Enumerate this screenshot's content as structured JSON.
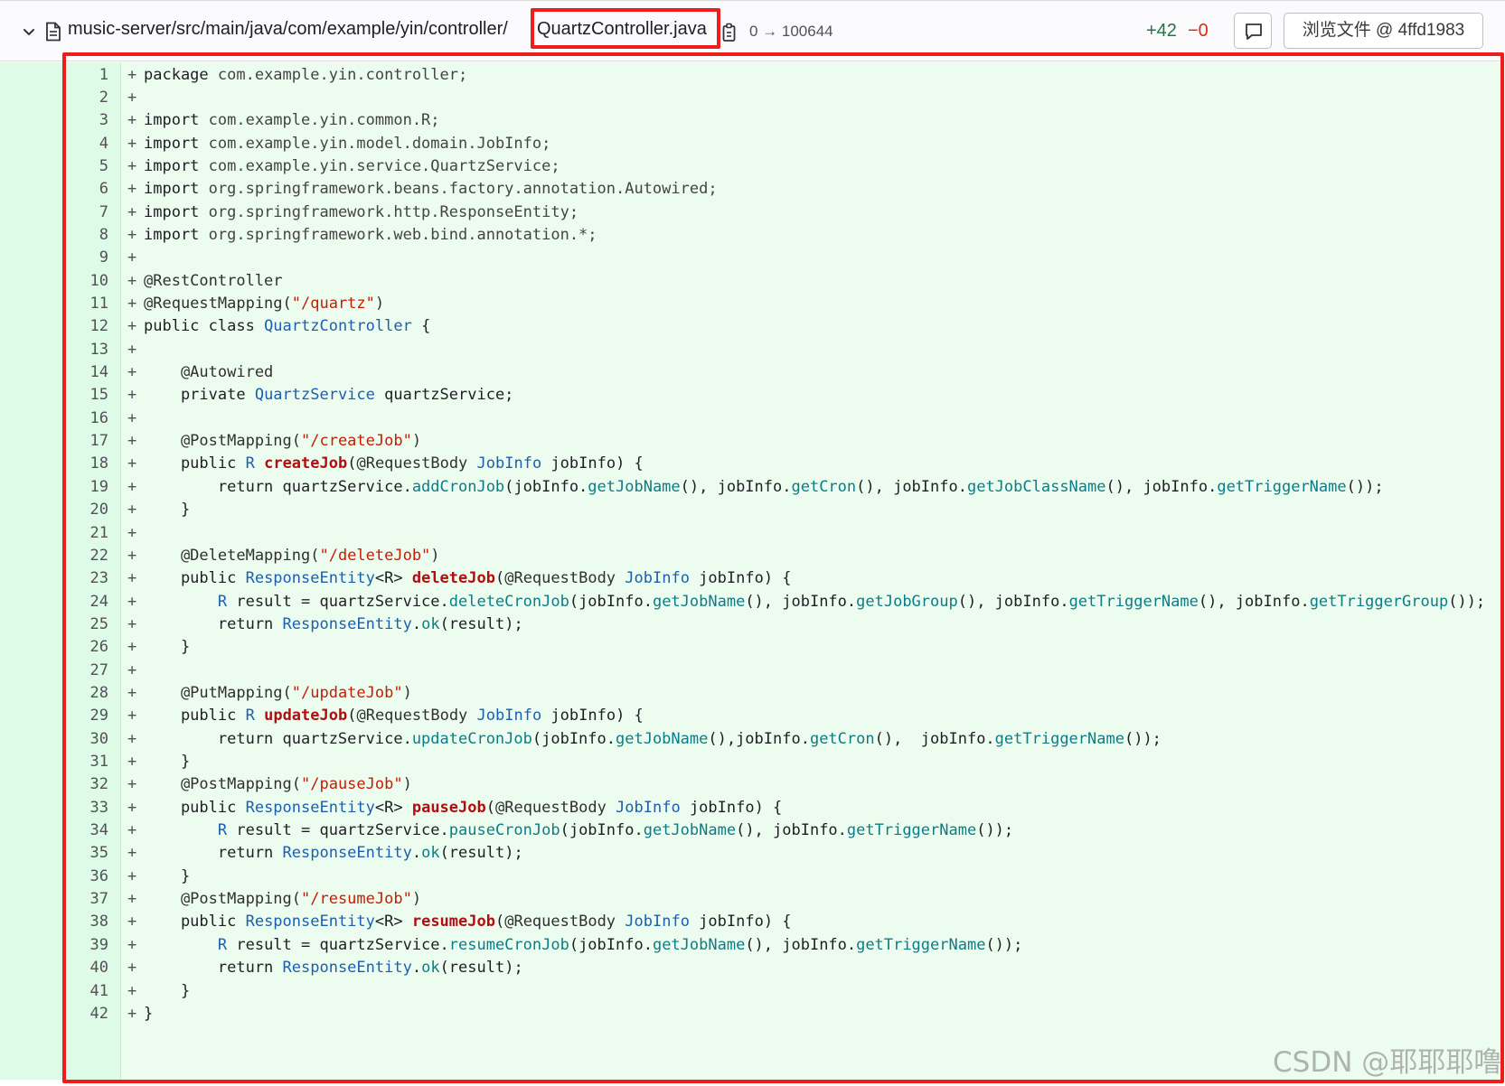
{
  "header": {
    "file_path": "music-server/src/main/java/com/example/yin/controller/",
    "file_name": "QuartzController.java",
    "mode_change": "0 → 100644",
    "additions": "+42",
    "deletions": "−0",
    "view_file_label": "浏览文件 @ 4ffd1983",
    "icons": [
      "chevron-down-icon",
      "file-icon",
      "copy-icon",
      "comment-icon"
    ]
  },
  "diff": {
    "lines": [
      {
        "n": "1",
        "tokens": [
          [
            "kw",
            "package"
          ],
          [
            "pkg",
            " com.example.yin.controller;"
          ]
        ]
      },
      {
        "n": "2",
        "tokens": []
      },
      {
        "n": "3",
        "tokens": [
          [
            "kw",
            "import"
          ],
          [
            "pkg",
            " com.example.yin.common.R;"
          ]
        ]
      },
      {
        "n": "4",
        "tokens": [
          [
            "kw",
            "import"
          ],
          [
            "pkg",
            " com.example.yin.model.domain.JobInfo;"
          ]
        ]
      },
      {
        "n": "5",
        "tokens": [
          [
            "kw",
            "import"
          ],
          [
            "pkg",
            " com.example.yin.service.QuartzService;"
          ]
        ]
      },
      {
        "n": "6",
        "tokens": [
          [
            "kw",
            "import"
          ],
          [
            "pkg",
            " org.springframework.beans.factory.annotation.Autowired;"
          ]
        ]
      },
      {
        "n": "7",
        "tokens": [
          [
            "kw",
            "import"
          ],
          [
            "pkg",
            " org.springframework.http.ResponseEntity;"
          ]
        ]
      },
      {
        "n": "8",
        "tokens": [
          [
            "kw",
            "import"
          ],
          [
            "pkg",
            " org.springframework.web.bind.annotation.*;"
          ]
        ]
      },
      {
        "n": "9",
        "tokens": []
      },
      {
        "n": "10",
        "tokens": [
          [
            "ann",
            "@RestController"
          ]
        ]
      },
      {
        "n": "11",
        "tokens": [
          [
            "ann",
            "@RequestMapping("
          ],
          [
            "str",
            "\"/quartz\""
          ],
          [
            "ann",
            ")"
          ]
        ]
      },
      {
        "n": "12",
        "tokens": [
          [
            "kw",
            "public class "
          ],
          [
            "type",
            "QuartzController"
          ],
          [
            "kw",
            " {"
          ]
        ]
      },
      {
        "n": "13",
        "tokens": []
      },
      {
        "n": "14",
        "tokens": [
          [
            "ann",
            "    @Autowired"
          ]
        ]
      },
      {
        "n": "15",
        "tokens": [
          [
            "kw",
            "    private "
          ],
          [
            "type",
            "QuartzService"
          ],
          [
            "kw",
            " quartzService;"
          ]
        ]
      },
      {
        "n": "16",
        "tokens": []
      },
      {
        "n": "17",
        "tokens": [
          [
            "ann",
            "    @PostMapping("
          ],
          [
            "str",
            "\"/createJob\""
          ],
          [
            "ann",
            ")"
          ]
        ]
      },
      {
        "n": "18",
        "tokens": [
          [
            "kw",
            "    public "
          ],
          [
            "type",
            "R"
          ],
          [
            "kw",
            " "
          ],
          [
            "def",
            "createJob"
          ],
          [
            "kw",
            "("
          ],
          [
            "ann",
            "@RequestBody "
          ],
          [
            "type",
            "JobInfo"
          ],
          [
            "kw",
            " jobInfo) {"
          ]
        ]
      },
      {
        "n": "19",
        "tokens": [
          [
            "kw",
            "        return quartzService."
          ],
          [
            "fn",
            "addCronJob"
          ],
          [
            "kw",
            "(jobInfo."
          ],
          [
            "fn",
            "getJobName"
          ],
          [
            "kw",
            "(), jobInfo."
          ],
          [
            "fn",
            "getCron"
          ],
          [
            "kw",
            "(), jobInfo."
          ],
          [
            "fn",
            "getJobClassName"
          ],
          [
            "kw",
            "(), jobInfo."
          ],
          [
            "fn",
            "getTriggerName"
          ],
          [
            "kw",
            "());"
          ]
        ]
      },
      {
        "n": "20",
        "tokens": [
          [
            "kw",
            "    }"
          ]
        ]
      },
      {
        "n": "21",
        "tokens": []
      },
      {
        "n": "22",
        "tokens": [
          [
            "ann",
            "    @DeleteMapping("
          ],
          [
            "str",
            "\"/deleteJob\""
          ],
          [
            "ann",
            ")"
          ]
        ]
      },
      {
        "n": "23",
        "tokens": [
          [
            "kw",
            "    public "
          ],
          [
            "type",
            "ResponseEntity"
          ],
          [
            "kw",
            "<R> "
          ],
          [
            "def",
            "deleteJob"
          ],
          [
            "kw",
            "("
          ],
          [
            "ann",
            "@RequestBody "
          ],
          [
            "type",
            "JobInfo"
          ],
          [
            "kw",
            " jobInfo) {"
          ]
        ]
      },
      {
        "n": "24",
        "tokens": [
          [
            "type",
            "        R"
          ],
          [
            "kw",
            " result = quartzService."
          ],
          [
            "fn",
            "deleteCronJob"
          ],
          [
            "kw",
            "(jobInfo."
          ],
          [
            "fn",
            "getJobName"
          ],
          [
            "kw",
            "(), jobInfo."
          ],
          [
            "fn",
            "getJobGroup"
          ],
          [
            "kw",
            "(), jobInfo."
          ],
          [
            "fn",
            "getTriggerName"
          ],
          [
            "kw",
            "(), jobInfo."
          ],
          [
            "fn",
            "getTriggerGroup"
          ],
          [
            "kw",
            "());"
          ]
        ]
      },
      {
        "n": "25",
        "tokens": [
          [
            "kw",
            "        return "
          ],
          [
            "type",
            "ResponseEntity"
          ],
          [
            "kw",
            "."
          ],
          [
            "fn",
            "ok"
          ],
          [
            "kw",
            "(result);"
          ]
        ]
      },
      {
        "n": "26",
        "tokens": [
          [
            "kw",
            "    }"
          ]
        ]
      },
      {
        "n": "27",
        "tokens": []
      },
      {
        "n": "28",
        "tokens": [
          [
            "ann",
            "    @PutMapping("
          ],
          [
            "str",
            "\"/updateJob\""
          ],
          [
            "ann",
            ")"
          ]
        ]
      },
      {
        "n": "29",
        "tokens": [
          [
            "kw",
            "    public "
          ],
          [
            "type",
            "R"
          ],
          [
            "kw",
            " "
          ],
          [
            "def",
            "updateJob"
          ],
          [
            "kw",
            "("
          ],
          [
            "ann",
            "@RequestBody "
          ],
          [
            "type",
            "JobInfo"
          ],
          [
            "kw",
            " jobInfo) {"
          ]
        ]
      },
      {
        "n": "30",
        "tokens": [
          [
            "kw",
            "        return quartzService."
          ],
          [
            "fn",
            "updateCronJob"
          ],
          [
            "kw",
            "(jobInfo."
          ],
          [
            "fn",
            "getJobName"
          ],
          [
            "kw",
            "(),jobInfo."
          ],
          [
            "fn",
            "getCron"
          ],
          [
            "kw",
            "(),  jobInfo."
          ],
          [
            "fn",
            "getTriggerName"
          ],
          [
            "kw",
            "());"
          ]
        ]
      },
      {
        "n": "31",
        "tokens": [
          [
            "kw",
            "    }"
          ]
        ]
      },
      {
        "n": "32",
        "tokens": [
          [
            "ann",
            "    @PostMapping("
          ],
          [
            "str",
            "\"/pauseJob\""
          ],
          [
            "ann",
            ")"
          ]
        ]
      },
      {
        "n": "33",
        "tokens": [
          [
            "kw",
            "    public "
          ],
          [
            "type",
            "ResponseEntity"
          ],
          [
            "kw",
            "<R> "
          ],
          [
            "def",
            "pauseJob"
          ],
          [
            "kw",
            "("
          ],
          [
            "ann",
            "@RequestBody "
          ],
          [
            "type",
            "JobInfo"
          ],
          [
            "kw",
            " jobInfo) {"
          ]
        ]
      },
      {
        "n": "34",
        "tokens": [
          [
            "type",
            "        R"
          ],
          [
            "kw",
            " result = quartzService."
          ],
          [
            "fn",
            "pauseCronJob"
          ],
          [
            "kw",
            "(jobInfo."
          ],
          [
            "fn",
            "getJobName"
          ],
          [
            "kw",
            "(), jobInfo."
          ],
          [
            "fn",
            "getTriggerName"
          ],
          [
            "kw",
            "());"
          ]
        ]
      },
      {
        "n": "35",
        "tokens": [
          [
            "kw",
            "        return "
          ],
          [
            "type",
            "ResponseEntity"
          ],
          [
            "kw",
            "."
          ],
          [
            "fn",
            "ok"
          ],
          [
            "kw",
            "(result);"
          ]
        ]
      },
      {
        "n": "36",
        "tokens": [
          [
            "kw",
            "    }"
          ]
        ]
      },
      {
        "n": "37",
        "tokens": [
          [
            "ann",
            "    @PostMapping("
          ],
          [
            "str",
            "\"/resumeJob\""
          ],
          [
            "ann",
            ")"
          ]
        ]
      },
      {
        "n": "38",
        "tokens": [
          [
            "kw",
            "    public "
          ],
          [
            "type",
            "ResponseEntity"
          ],
          [
            "kw",
            "<R> "
          ],
          [
            "def",
            "resumeJob"
          ],
          [
            "kw",
            "("
          ],
          [
            "ann",
            "@RequestBody "
          ],
          [
            "type",
            "JobInfo"
          ],
          [
            "kw",
            " jobInfo) {"
          ]
        ]
      },
      {
        "n": "39",
        "tokens": [
          [
            "type",
            "        R"
          ],
          [
            "kw",
            " result = quartzService."
          ],
          [
            "fn",
            "resumeCronJob"
          ],
          [
            "kw",
            "(jobInfo."
          ],
          [
            "fn",
            "getJobName"
          ],
          [
            "kw",
            "(), jobInfo."
          ],
          [
            "fn",
            "getTriggerName"
          ],
          [
            "kw",
            "());"
          ]
        ]
      },
      {
        "n": "40",
        "tokens": [
          [
            "kw",
            "        return "
          ],
          [
            "type",
            "ResponseEntity"
          ],
          [
            "kw",
            "."
          ],
          [
            "fn",
            "ok"
          ],
          [
            "kw",
            "(result);"
          ]
        ]
      },
      {
        "n": "41",
        "tokens": [
          [
            "kw",
            "    }"
          ]
        ]
      },
      {
        "n": "42",
        "tokens": [
          [
            "kw",
            "}"
          ]
        ]
      }
    ]
  },
  "watermark": "CSDN @耶耶耶噜",
  "colors": {
    "added_bg": "#ecfdf0",
    "gutter_bg": "#ddfbe6",
    "highlight_border": "#ef1c1c"
  }
}
